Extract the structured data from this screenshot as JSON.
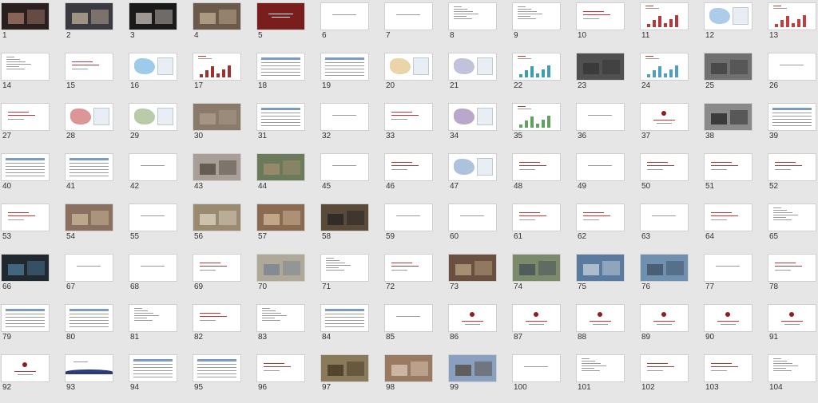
{
  "slides": [
    {
      "n": "1",
      "kind": "photo",
      "bg": "#2a1f1f",
      "accent": "#b08070"
    },
    {
      "n": "2",
      "kind": "photo",
      "bg": "#3a3a40",
      "accent": "#c9b8a0"
    },
    {
      "n": "3",
      "kind": "photo",
      "bg": "#1a1a1a",
      "accent": "#d8cfc6"
    },
    {
      "n": "4",
      "kind": "photo",
      "bg": "#6b5a4a",
      "accent": "#c7b39a"
    },
    {
      "n": "5",
      "kind": "title",
      "bg": "#7a1d1d",
      "accent": "#ffffff"
    },
    {
      "n": "6",
      "kind": "text"
    },
    {
      "n": "7",
      "kind": "text"
    },
    {
      "n": "8",
      "kind": "list"
    },
    {
      "n": "9",
      "kind": "list"
    },
    {
      "n": "10",
      "kind": "redtext"
    },
    {
      "n": "11",
      "kind": "chart",
      "accent": "#b33a3a"
    },
    {
      "n": "12",
      "kind": "map",
      "accent": "#6aa0d8"
    },
    {
      "n": "13",
      "kind": "chart",
      "accent": "#c04040"
    },
    {
      "n": "14",
      "kind": "list"
    },
    {
      "n": "15",
      "kind": "redtext"
    },
    {
      "n": "16",
      "kind": "map",
      "accent": "#4fa0d8"
    },
    {
      "n": "17",
      "kind": "chart",
      "accent": "#a03030"
    },
    {
      "n": "18",
      "kind": "table"
    },
    {
      "n": "19",
      "kind": "table"
    },
    {
      "n": "20",
      "kind": "map",
      "accent": "#d8b060"
    },
    {
      "n": "21",
      "kind": "map",
      "accent": "#9090c0"
    },
    {
      "n": "22",
      "kind": "chart",
      "accent": "#3aa0b0"
    },
    {
      "n": "23",
      "kind": "photo",
      "bg": "#505050",
      "accent": "#303030"
    },
    {
      "n": "24",
      "kind": "chart",
      "accent": "#4fa0c0"
    },
    {
      "n": "25",
      "kind": "photo",
      "bg": "#707070",
      "accent": "#3a3a3a"
    },
    {
      "n": "26",
      "kind": "text"
    },
    {
      "n": "27",
      "kind": "redtext"
    },
    {
      "n": "28",
      "kind": "map",
      "accent": "#c04040"
    },
    {
      "n": "29",
      "kind": "map",
      "accent": "#80a060"
    },
    {
      "n": "30",
      "kind": "photo",
      "bg": "#8a7a6a",
      "accent": "#b0a090"
    },
    {
      "n": "31",
      "kind": "table"
    },
    {
      "n": "32",
      "kind": "text"
    },
    {
      "n": "33",
      "kind": "redtext"
    },
    {
      "n": "34",
      "kind": "map",
      "accent": "#8060a0"
    },
    {
      "n": "35",
      "kind": "chart",
      "accent": "#60a060"
    },
    {
      "n": "36",
      "kind": "text"
    },
    {
      "n": "37",
      "kind": "logo"
    },
    {
      "n": "38",
      "kind": "photo",
      "bg": "#8a8a8a",
      "accent": "#1a1a1a"
    },
    {
      "n": "39",
      "kind": "table"
    },
    {
      "n": "40",
      "kind": "table"
    },
    {
      "n": "41",
      "kind": "table"
    },
    {
      "n": "42",
      "kind": "text"
    },
    {
      "n": "43",
      "kind": "photo",
      "bg": "#a8a098",
      "accent": "#4a4038"
    },
    {
      "n": "44",
      "kind": "photo",
      "bg": "#6a7a5a",
      "accent": "#a89070"
    },
    {
      "n": "45",
      "kind": "text"
    },
    {
      "n": "46",
      "kind": "redtext"
    },
    {
      "n": "47",
      "kind": "map",
      "accent": "#6a90c0"
    },
    {
      "n": "48",
      "kind": "redtext"
    },
    {
      "n": "49",
      "kind": "text"
    },
    {
      "n": "50",
      "kind": "redtext"
    },
    {
      "n": "51",
      "kind": "redtext"
    },
    {
      "n": "52",
      "kind": "redtext"
    },
    {
      "n": "53",
      "kind": "redtext"
    },
    {
      "n": "54",
      "kind": "photo",
      "bg": "#8a7060",
      "accent": "#d0c0a0"
    },
    {
      "n": "55",
      "kind": "text"
    },
    {
      "n": "56",
      "kind": "photo",
      "bg": "#9a8a70",
      "accent": "#e0d8c8"
    },
    {
      "n": "57",
      "kind": "photo",
      "bg": "#8a6a50",
      "accent": "#d8c0a0"
    },
    {
      "n": "58",
      "kind": "photo",
      "bg": "#5a4a3a",
      "accent": "#202020"
    },
    {
      "n": "59",
      "kind": "text"
    },
    {
      "n": "60",
      "kind": "text"
    },
    {
      "n": "61",
      "kind": "redtext"
    },
    {
      "n": "62",
      "kind": "redtext"
    },
    {
      "n": "63",
      "kind": "text"
    },
    {
      "n": "64",
      "kind": "redtext"
    },
    {
      "n": "65",
      "kind": "list"
    },
    {
      "n": "66",
      "kind": "photo",
      "bg": "#202830",
      "accent": "#5080a0"
    },
    {
      "n": "67",
      "kind": "text"
    },
    {
      "n": "68",
      "kind": "text"
    },
    {
      "n": "69",
      "kind": "redtext"
    },
    {
      "n": "70",
      "kind": "photo",
      "bg": "#b0a898",
      "accent": "#708090"
    },
    {
      "n": "71",
      "kind": "list"
    },
    {
      "n": "72",
      "kind": "redtext"
    },
    {
      "n": "73",
      "kind": "photo",
      "bg": "#6a5040",
      "accent": "#c0a888"
    },
    {
      "n": "74",
      "kind": "photo",
      "bg": "#7a8a6a",
      "accent": "#404858"
    },
    {
      "n": "75",
      "kind": "photo",
      "bg": "#5a7aa0",
      "accent": "#d0d8e0"
    },
    {
      "n": "76",
      "kind": "photo",
      "bg": "#7090b0",
      "accent": "#3a4a5a"
    },
    {
      "n": "77",
      "kind": "text"
    },
    {
      "n": "78",
      "kind": "redtext"
    },
    {
      "n": "79",
      "kind": "table"
    },
    {
      "n": "80",
      "kind": "table"
    },
    {
      "n": "81",
      "kind": "list"
    },
    {
      "n": "82",
      "kind": "redtext"
    },
    {
      "n": "83",
      "kind": "list"
    },
    {
      "n": "84",
      "kind": "table"
    },
    {
      "n": "85",
      "kind": "text"
    },
    {
      "n": "86",
      "kind": "logo"
    },
    {
      "n": "87",
      "kind": "logo"
    },
    {
      "n": "88",
      "kind": "logo"
    },
    {
      "n": "89",
      "kind": "logo"
    },
    {
      "n": "90",
      "kind": "logo"
    },
    {
      "n": "91",
      "kind": "logo"
    },
    {
      "n": "92",
      "kind": "logo"
    },
    {
      "n": "93",
      "kind": "wave",
      "accent": "#2a3a7a"
    },
    {
      "n": "94",
      "kind": "table"
    },
    {
      "n": "95",
      "kind": "table"
    },
    {
      "n": "96",
      "kind": "redtext"
    },
    {
      "n": "97",
      "kind": "photo",
      "bg": "#8a7a5a",
      "accent": "#3a3020"
    },
    {
      "n": "98",
      "kind": "photo",
      "bg": "#9a7a60",
      "accent": "#e0d0c0"
    },
    {
      "n": "99",
      "kind": "photo",
      "bg": "#8aa0c0",
      "accent": "#504030"
    },
    {
      "n": "100",
      "kind": "text"
    },
    {
      "n": "101",
      "kind": "list"
    },
    {
      "n": "102",
      "kind": "redtext"
    },
    {
      "n": "103",
      "kind": "redtext"
    },
    {
      "n": "104",
      "kind": "list"
    }
  ]
}
